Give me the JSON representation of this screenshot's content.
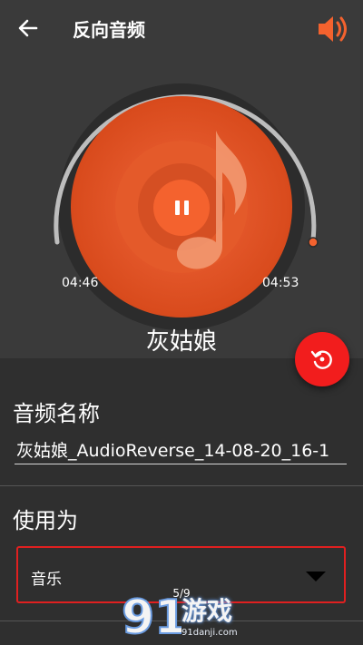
{
  "header": {
    "title": "反向音频",
    "back_icon": "arrow-left-icon",
    "volume_icon": "speaker-icon"
  },
  "player": {
    "current_time": "04:46",
    "total_time": "04:53",
    "song_name": "灰姑娘",
    "progress": 0.97,
    "state": "playing"
  },
  "form": {
    "name_label": "音频名称",
    "name_value": "灰姑娘_AudioReverse_14-08-20_16-1",
    "use_label": "使用为",
    "use_value": "音乐"
  },
  "pager": {
    "indicator": "5/9"
  },
  "watermark": {
    "text": "游戏",
    "sub": "91danji.com",
    "logo_text": "91"
  },
  "colors": {
    "accent": "#f4622e",
    "fab": "#f21d1d",
    "background": "#3a3a3a",
    "select_border": "#e02020"
  }
}
